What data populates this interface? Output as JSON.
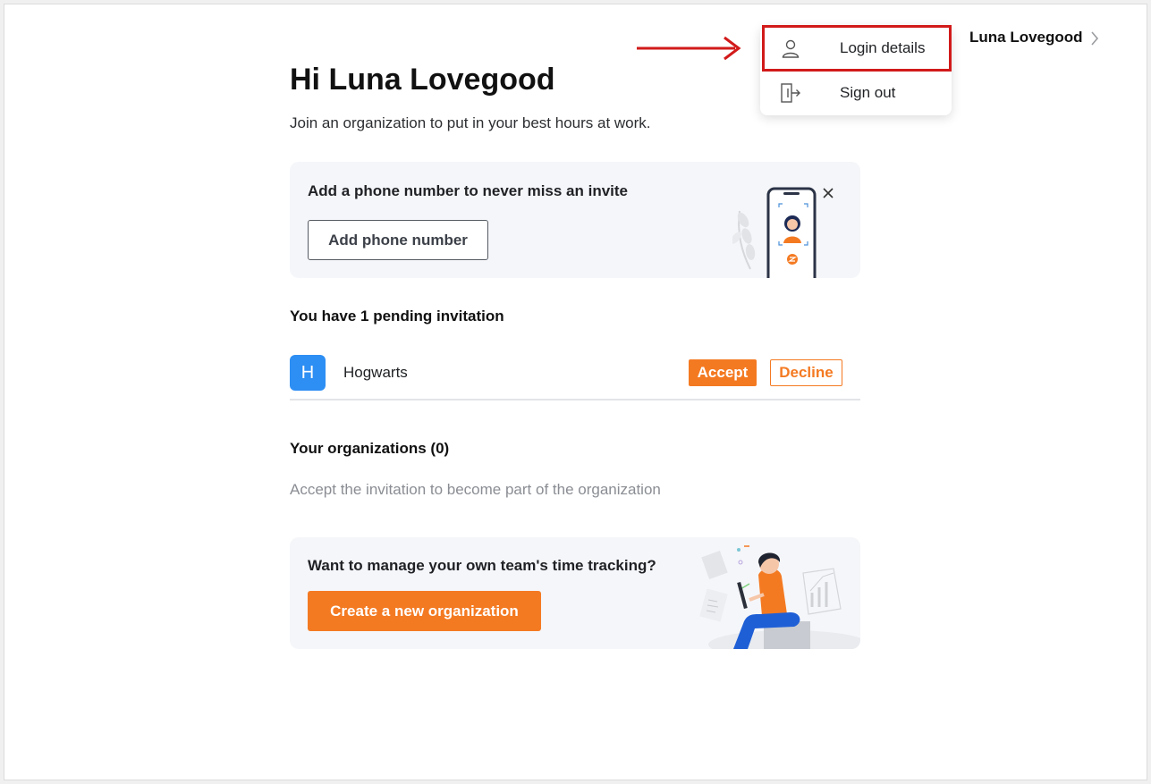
{
  "header": {
    "user_name": "Luna Lovegood"
  },
  "user_menu": {
    "items": [
      {
        "label": "Login details",
        "icon": "user-icon"
      },
      {
        "label": "Sign out",
        "icon": "sign-out-icon"
      }
    ]
  },
  "main": {
    "greeting": "Hi Luna Lovegood",
    "subtitle": "Join an organization to put in your best hours at work."
  },
  "phone_card": {
    "title": "Add a phone number to never miss an invite",
    "button_label": "Add phone number"
  },
  "invitations": {
    "title": "You have 1 pending invitation",
    "items": [
      {
        "avatar_letter": "H",
        "name": "Hogwarts",
        "accept_label": "Accept",
        "decline_label": "Decline"
      }
    ]
  },
  "organizations": {
    "title": "Your organizations (0)",
    "empty_text": "Accept the invitation to become part of the organization"
  },
  "create_card": {
    "title": "Want to manage your own team's time tracking?",
    "button_label": "Create a new organization"
  },
  "colors": {
    "accent": "#f47a22",
    "avatar_blue": "#2d8ef3",
    "annotation_red": "#d21a1a",
    "card_bg": "#f5f6f9"
  }
}
